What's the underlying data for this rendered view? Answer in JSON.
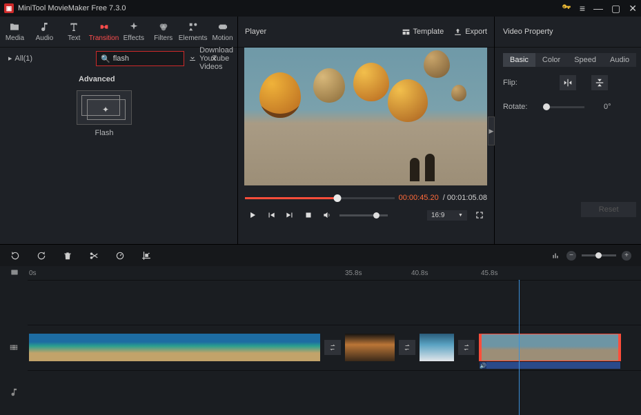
{
  "titlebar": {
    "title": "MiniTool MovieMaker Free 7.3.0"
  },
  "toolbar": {
    "items": [
      {
        "label": "Media"
      },
      {
        "label": "Audio"
      },
      {
        "label": "Text"
      },
      {
        "label": "Transition"
      },
      {
        "label": "Effects"
      },
      {
        "label": "Filters"
      },
      {
        "label": "Elements"
      },
      {
        "label": "Motion"
      }
    ]
  },
  "browser": {
    "all_label": "All(1)",
    "search_value": "flash",
    "download_yt_label": "Download YouTube Videos"
  },
  "transitions": {
    "section_title": "Advanced",
    "items": [
      {
        "name": "Flash"
      }
    ]
  },
  "player": {
    "label": "Player",
    "template_label": "Template",
    "export_label": "Export",
    "time_current": "00:00:45.20",
    "time_sep": " / ",
    "time_total": "00:01:05.08",
    "ratio": "16:9"
  },
  "property": {
    "title": "Video Property",
    "tabs": {
      "basic": "Basic",
      "color": "Color",
      "speed": "Speed",
      "audio": "Audio"
    },
    "flip_label": "Flip:",
    "rotate_label": "Rotate:",
    "rotate_value": "0°",
    "reset_label": "Reset"
  },
  "ruler": {
    "t0": "0s",
    "t1": "35.8s",
    "t2": "40.8s",
    "t3": "45.8s"
  }
}
